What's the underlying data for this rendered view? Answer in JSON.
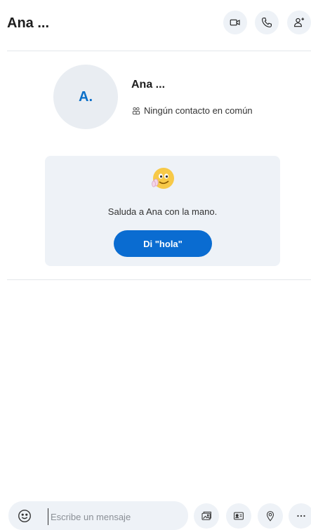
{
  "header": {
    "title": "Ana ...",
    "icons": [
      "video-call-icon",
      "audio-call-icon",
      "add-person-icon"
    ]
  },
  "profile": {
    "initials": "A.",
    "name": "Ana ...",
    "mutual_contacts": "Ningún contacto en común",
    "mutual_icon": "people-icon"
  },
  "wave_card": {
    "emoji": "waving-emoji",
    "message": "Saluda a Ana con la mano.",
    "button_label": "Di \"hola\""
  },
  "composer": {
    "placeholder": "Escribe un mensaje",
    "icons": [
      "emoji-icon",
      "media-gallery-icon",
      "contact-card-icon",
      "location-icon",
      "more-icon"
    ]
  },
  "colors": {
    "accent": "#0a6cd1",
    "initials": "#0b6fc8",
    "surface": "#eef2f7"
  }
}
